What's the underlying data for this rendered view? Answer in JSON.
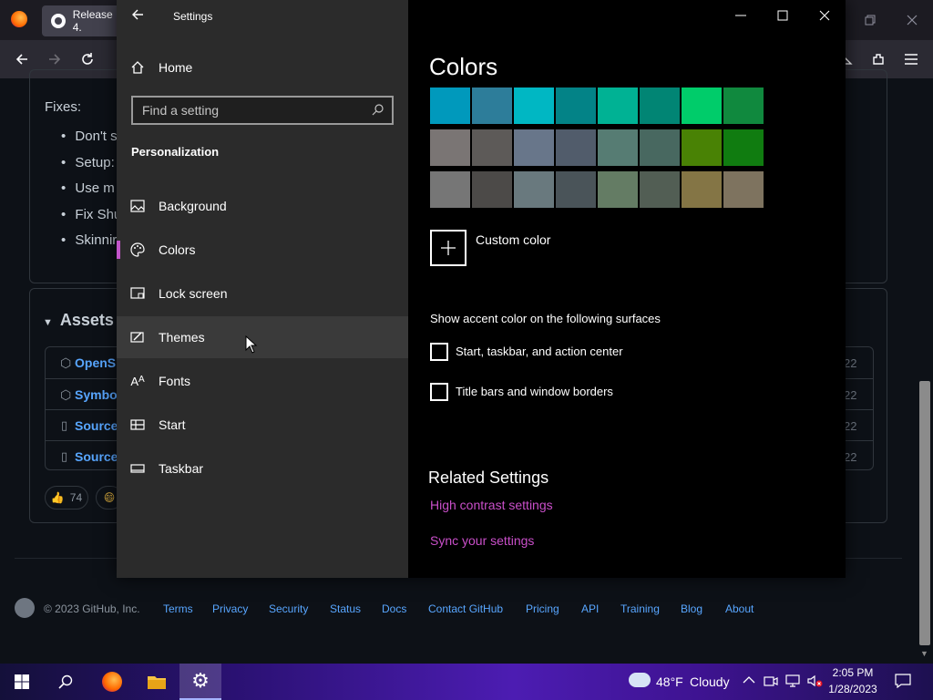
{
  "browser": {
    "tab_title": "Release 4.",
    "nav_icons": [
      "back-arrow-icon",
      "forward-arrow-icon",
      "reload-icon"
    ],
    "right_icons": [
      "extensions-icon",
      "menu-icon"
    ]
  },
  "github": {
    "fixes_heading": "Fixes:",
    "fix_items": [
      "Don't s",
      "Setup:",
      "Use m",
      "Fix Shu",
      "Skinnir"
    ],
    "assets_heading": "Assets",
    "assets": [
      {
        "name": "OpenSl",
        "count": "22",
        "icon": "package-icon"
      },
      {
        "name": "Symbol",
        "count": "22",
        "icon": "package-icon"
      },
      {
        "name": "Source",
        "count": "22",
        "icon": "zip-icon"
      },
      {
        "name": "Source",
        "count": "22",
        "icon": "zip-icon"
      }
    ],
    "reaction_count": "74",
    "footer": {
      "copyright": "© 2023 GitHub, Inc.",
      "links": [
        "Terms",
        "Privacy",
        "Security",
        "Status",
        "Docs",
        "Contact GitHub",
        "Pricing",
        "API",
        "Training",
        "Blog",
        "About"
      ]
    }
  },
  "settings": {
    "title": "Settings",
    "home_label": "Home",
    "search_placeholder": "Find a setting",
    "section": "Personalization",
    "nav_items": [
      {
        "label": "Background",
        "icon": "image-icon"
      },
      {
        "label": "Colors",
        "icon": "palette-icon"
      },
      {
        "label": "Lock screen",
        "icon": "lock-screen-icon"
      },
      {
        "label": "Themes",
        "icon": "themes-icon"
      },
      {
        "label": "Fonts",
        "icon": "fonts-icon"
      },
      {
        "label": "Start",
        "icon": "start-icon"
      },
      {
        "label": "Taskbar",
        "icon": "taskbar-icon"
      }
    ],
    "selected_item": "Colors",
    "hovered_item": "Themes",
    "page_title": "Colors",
    "swatches": [
      [
        "#0099bc",
        "#2d7d9a",
        "#00b7c3",
        "#038387",
        "#00b294",
        "#018574",
        "#00cc6a",
        "#10893e"
      ],
      [
        "#7a7574",
        "#5d5a58",
        "#68768a",
        "#515c6b",
        "#567c73",
        "#486860",
        "#498205",
        "#107c10"
      ],
      [
        "#767676",
        "#4c4a48",
        "#69797e",
        "#4a5459",
        "#647c64",
        "#525e54",
        "#847545",
        "#7e735f"
      ]
    ],
    "custom_color_label": "Custom color",
    "accent_surfaces_heading": "Show accent color on the following surfaces",
    "checkbox_start": "Start, taskbar, and action center",
    "checkbox_titlebars": "Title bars and window borders",
    "related_heading": "Related Settings",
    "link_high_contrast": "High contrast settings",
    "link_sync": "Sync your settings",
    "accent_color": "#c255c9"
  },
  "taskbar": {
    "weather_temp": "48°F",
    "weather_desc": "Cloudy",
    "time": "2:05 PM",
    "date": "1/28/2023"
  }
}
